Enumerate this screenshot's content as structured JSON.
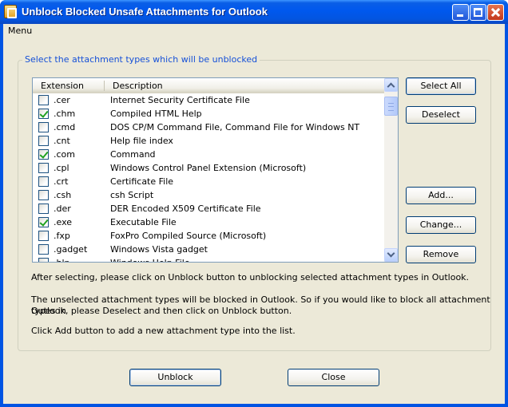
{
  "window": {
    "title": "Unblock Blocked Unsafe Attachments for Outlook"
  },
  "menubar": {
    "menu_label": "Menu"
  },
  "group": {
    "title": "Select the attachment types which will be unblocked"
  },
  "list": {
    "columns": [
      "Extension",
      "Description"
    ],
    "rows": [
      {
        "ext": ".cer",
        "desc": "Internet Security Certificate File",
        "checked": false
      },
      {
        "ext": ".chm",
        "desc": "Compiled HTML Help",
        "checked": true
      },
      {
        "ext": ".cmd",
        "desc": "DOS CP/M Command File, Command File for Windows NT",
        "checked": false
      },
      {
        "ext": ".cnt",
        "desc": "Help file index",
        "checked": false
      },
      {
        "ext": ".com",
        "desc": "Command",
        "checked": true
      },
      {
        "ext": ".cpl",
        "desc": "Windows Control Panel Extension (Microsoft)",
        "checked": false
      },
      {
        "ext": ".crt",
        "desc": "Certificate File",
        "checked": false
      },
      {
        "ext": ".csh",
        "desc": "csh Script",
        "checked": false
      },
      {
        "ext": ".der",
        "desc": "DER Encoded X509 Certificate File",
        "checked": false
      },
      {
        "ext": ".exe",
        "desc": "Executable File",
        "checked": true
      },
      {
        "ext": ".fxp",
        "desc": "FoxPro Compiled Source (Microsoft)",
        "checked": false
      },
      {
        "ext": ".gadget",
        "desc": "Windows Vista gadget",
        "checked": false
      },
      {
        "ext": ".hlp",
        "desc": "Windows Help File",
        "checked": false
      }
    ]
  },
  "buttons": {
    "select_all": "Select All",
    "deselect": "Deselect",
    "add": "Add...",
    "change": "Change...",
    "remove": "Remove",
    "unblock": "Unblock",
    "close": "Close"
  },
  "info": {
    "line1": "After selecting, please click on Unblock button to unblocking selected attachment types in Outlook.",
    "line2a": "The unselected attachment types will be blocked in Outlook. So if you would like to block all attachment types in",
    "line2b": "Outlook, please Deselect and then click on Unblock button.",
    "line3": "Click Add button to add a new attachment type into the list."
  }
}
